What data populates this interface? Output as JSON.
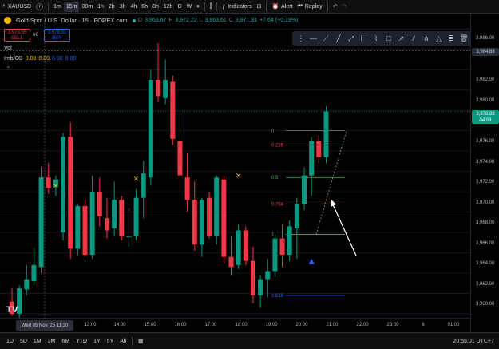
{
  "toolbar": {
    "symbol": "XAUUSD",
    "add_symbol": "+",
    "intervals": [
      "1m",
      "15m",
      "30m",
      "1h",
      "2h",
      "3h",
      "4h",
      "6h",
      "8h",
      "12h",
      "D",
      "W"
    ],
    "active_interval": "15m",
    "interval_dropdown": "▾",
    "indicators_label": "Indicators",
    "alert_label": "Alert",
    "replay_label": "Replay"
  },
  "legend": {
    "title": "Gold Spot / U.S. Dollar · 15 · FOREX.com",
    "ohlc": {
      "o_key": "O",
      "o": "3,963.67",
      "h_key": "H",
      "h": "3,972.22",
      "l_key": "L",
      "l": "3,963.61",
      "c_key": "C",
      "c": "3,971.31",
      "change": "+7.64 (+0.19%)"
    },
    "sell_price": "3,978.55",
    "sell_label": "SELL",
    "spread": "66",
    "buy_price": "3,979.31",
    "buy_label": "BUY",
    "vol_label": "Vol",
    "imb_label": "Imb/OB",
    "imb_values": [
      "0.00",
      "0.00",
      "0.00",
      "0.00"
    ]
  },
  "drawing_tools": [
    "horizontal-line-icon",
    "ray-icon",
    "extended-line-icon",
    "trend-line-icon",
    "measure-icon",
    "path-icon",
    "rectangle-icon",
    "arrow-icon",
    "parallel-channel-icon",
    "pitchfork-icon",
    "triangle-icon",
    "fib-icon",
    "trash-icon"
  ],
  "price_axis": {
    "labels": [
      "3,986.00",
      "3,982.00",
      "3,980.00",
      "3,976.00",
      "3,974.00",
      "3,972.00",
      "3,970.00",
      "3,968.00",
      "3,966.00",
      "3,964.00",
      "3,962.00",
      "3,960.00"
    ],
    "crosshair_price": "3,984.88",
    "current_price": "3,978.88",
    "countdown": "04:59"
  },
  "time_axis": {
    "current_label": "Wed 05 Nov '25  11:30",
    "labels": [
      "13:00",
      "14:00",
      "15:00",
      "16:00",
      "17:00",
      "18:00",
      "19:00",
      "20:00",
      "21:00",
      "22:00",
      "23:00",
      "6",
      "01:00"
    ]
  },
  "bottom_bar": {
    "ranges": [
      "1D",
      "5D",
      "1M",
      "3M",
      "6M",
      "YTD",
      "1Y",
      "5Y",
      "All"
    ],
    "clock": "20:55:01 UTC+7"
  },
  "chart_data": {
    "type": "candlestick",
    "symbol": "XAUUSD",
    "timeframe": "15",
    "y_range": [
      3958.6,
      3988.2
    ],
    "up_color": "#089981",
    "down_color": "#f23645",
    "candles": [
      {
        "o": 3960.2,
        "h": 3961.6,
        "l": 3958.8,
        "c": 3959.0
      },
      {
        "o": 3959.0,
        "h": 3961.8,
        "l": 3958.4,
        "c": 3961.5
      },
      {
        "o": 3961.4,
        "h": 3963.8,
        "l": 3960.8,
        "c": 3962.4
      },
      {
        "o": 3962.2,
        "h": 3965.4,
        "l": 3961.8,
        "c": 3963.8
      },
      {
        "o": 3963.6,
        "h": 3973.4,
        "l": 3963.0,
        "c": 3972.4
      },
      {
        "o": 3972.4,
        "h": 3973.8,
        "l": 3970.8,
        "c": 3971.4
      },
      {
        "o": 3971.5,
        "h": 3972.6,
        "l": 3970.6,
        "c": 3972.2
      },
      {
        "o": 3967.0,
        "h": 3976.8,
        "l": 3966.2,
        "c": 3976.4
      },
      {
        "o": 3976.4,
        "h": 3977.8,
        "l": 3964.4,
        "c": 3965.4
      },
      {
        "o": 3965.4,
        "h": 3969.8,
        "l": 3964.8,
        "c": 3969.6
      },
      {
        "o": 3969.6,
        "h": 3970.2,
        "l": 3964.6,
        "c": 3964.8
      },
      {
        "o": 3964.8,
        "h": 3972.6,
        "l": 3964.4,
        "c": 3971.0
      },
      {
        "o": 3971.0,
        "h": 3972.4,
        "l": 3967.6,
        "c": 3968.6
      },
      {
        "o": 3968.4,
        "h": 3970.4,
        "l": 3966.4,
        "c": 3967.2
      },
      {
        "o": 3967.4,
        "h": 3972.0,
        "l": 3966.6,
        "c": 3970.2
      },
      {
        "o": 3970.2,
        "h": 3970.6,
        "l": 3966.2,
        "c": 3966.6
      },
      {
        "o": 3966.6,
        "h": 3969.4,
        "l": 3965.6,
        "c": 3966.6
      },
      {
        "o": 3966.6,
        "h": 3971.2,
        "l": 3966.2,
        "c": 3970.4
      },
      {
        "o": 3970.4,
        "h": 3974.0,
        "l": 3968.4,
        "c": 3972.8
      },
      {
        "o": 3972.4,
        "h": 3983.0,
        "l": 3971.6,
        "c": 3982.0
      },
      {
        "o": 3982.0,
        "h": 3985.6,
        "l": 3979.8,
        "c": 3980.4
      },
      {
        "o": 3980.2,
        "h": 3984.0,
        "l": 3979.6,
        "c": 3982.0
      },
      {
        "o": 3981.8,
        "h": 3982.4,
        "l": 3975.6,
        "c": 3976.2
      },
      {
        "o": 3976.0,
        "h": 3979.0,
        "l": 3971.0,
        "c": 3972.6
      },
      {
        "o": 3972.4,
        "h": 3974.8,
        "l": 3969.0,
        "c": 3970.2
      },
      {
        "o": 3970.2,
        "h": 3972.0,
        "l": 3965.2,
        "c": 3965.8
      },
      {
        "o": 3965.8,
        "h": 3970.4,
        "l": 3964.6,
        "c": 3970.2
      },
      {
        "o": 3970.4,
        "h": 3971.0,
        "l": 3966.4,
        "c": 3966.6
      },
      {
        "o": 3966.6,
        "h": 3972.6,
        "l": 3965.8,
        "c": 3972.4
      },
      {
        "o": 3972.2,
        "h": 3972.6,
        "l": 3964.0,
        "c": 3964.6
      },
      {
        "o": 3964.6,
        "h": 3966.6,
        "l": 3962.8,
        "c": 3963.6
      },
      {
        "o": 3963.8,
        "h": 3967.8,
        "l": 3963.4,
        "c": 3967.2
      },
      {
        "o": 3967.2,
        "h": 3967.6,
        "l": 3963.8,
        "c": 3964.2
      },
      {
        "o": 3964.2,
        "h": 3965.6,
        "l": 3960.0,
        "c": 3960.8
      },
      {
        "o": 3960.8,
        "h": 3962.8,
        "l": 3959.6,
        "c": 3962.4
      },
      {
        "o": 3962.4,
        "h": 3964.4,
        "l": 3960.6,
        "c": 3963.2
      },
      {
        "o": 3963.2,
        "h": 3966.8,
        "l": 3962.6,
        "c": 3966.4
      },
      {
        "o": 3966.4,
        "h": 3967.8,
        "l": 3963.6,
        "c": 3964.8
      },
      {
        "o": 3964.8,
        "h": 3968.2,
        "l": 3964.2,
        "c": 3967.6
      },
      {
        "o": 3967.4,
        "h": 3970.4,
        "l": 3964.4,
        "c": 3969.8
      },
      {
        "o": 3969.8,
        "h": 3973.4,
        "l": 3969.2,
        "c": 3972.6
      },
      {
        "o": 3972.6,
        "h": 3976.4,
        "l": 3970.6,
        "c": 3976.0
      },
      {
        "o": 3976.0,
        "h": 3976.6,
        "l": 3973.8,
        "c": 3974.4
      },
      {
        "o": 3974.4,
        "h": 3979.4,
        "l": 3973.8,
        "c": 3978.9
      }
    ],
    "markers": [
      {
        "index": 6,
        "price": 3971.6,
        "symbol": "×",
        "color": "#f5c400"
      },
      {
        "index": 17,
        "price": 3972.3,
        "symbol": "×",
        "color": "#f5c400"
      },
      {
        "index": 31,
        "price": 3972.6,
        "symbol": "×",
        "color": "#f5c400"
      },
      {
        "index": 41,
        "price": 3964.2,
        "symbol": "▲",
        "color": "#2962ff"
      }
    ],
    "fib_levels": [
      {
        "label": "0",
        "price": 3977.0,
        "color": "#787b86"
      },
      {
        "label": "0.236",
        "price": 3975.6,
        "color": "#f23645"
      },
      {
        "label": "0.5",
        "price": 3972.4,
        "color": "#4caf50"
      },
      {
        "label": "0.764",
        "price": 3969.8,
        "color": "#f23645"
      },
      {
        "label": "1",
        "price": 3966.8,
        "color": "#4caf50"
      },
      {
        "label": "1.618",
        "price": 3960.8,
        "color": "#2962ff"
      }
    ],
    "crosshair_price": 3984.88,
    "last_price": 3978.88
  }
}
